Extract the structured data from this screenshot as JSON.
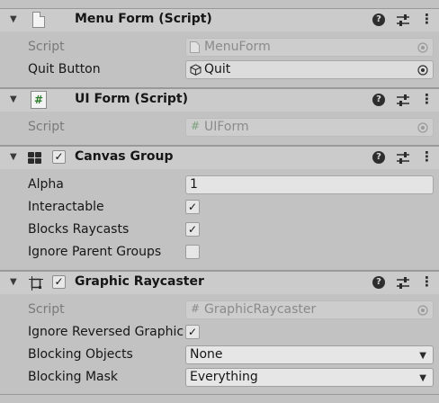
{
  "components": {
    "menu_form": {
      "title": "Menu Form (Script)",
      "script_label": "Script",
      "script_value": "MenuForm",
      "quit_label": "Quit Button",
      "quit_value": "Quit"
    },
    "ui_form": {
      "title": "UI Form (Script)",
      "script_label": "Script",
      "script_value": "UIForm",
      "hash_glyph": "#"
    },
    "canvas_group": {
      "title": "Canvas Group",
      "enabled": true,
      "alpha_label": "Alpha",
      "alpha_value": "1",
      "interactable_label": "Interactable",
      "interactable": true,
      "blocks_raycasts_label": "Blocks Raycasts",
      "blocks_raycasts": true,
      "ignore_parent_label": "Ignore Parent Groups",
      "ignore_parent": false
    },
    "graphic_raycaster": {
      "title": "Graphic Raycaster",
      "enabled": true,
      "script_label": "Script",
      "script_value": "GraphicRaycaster",
      "ignore_reversed_label": "Ignore Reversed Graphic",
      "ignore_reversed": true,
      "blocking_objects_label": "Blocking Objects",
      "blocking_objects_value": "None",
      "blocking_mask_label": "Blocking Mask",
      "blocking_mask_value": "Everything"
    }
  },
  "glyphs": {
    "fold": "▼",
    "check": "✓",
    "help": "?",
    "kebab": "⋮",
    "dropdown": "▼"
  },
  "colors": {
    "background": "#c2c2c2",
    "header": "#cbcbcb",
    "text": "#161616",
    "disabled_text": "#7a7a7a"
  }
}
